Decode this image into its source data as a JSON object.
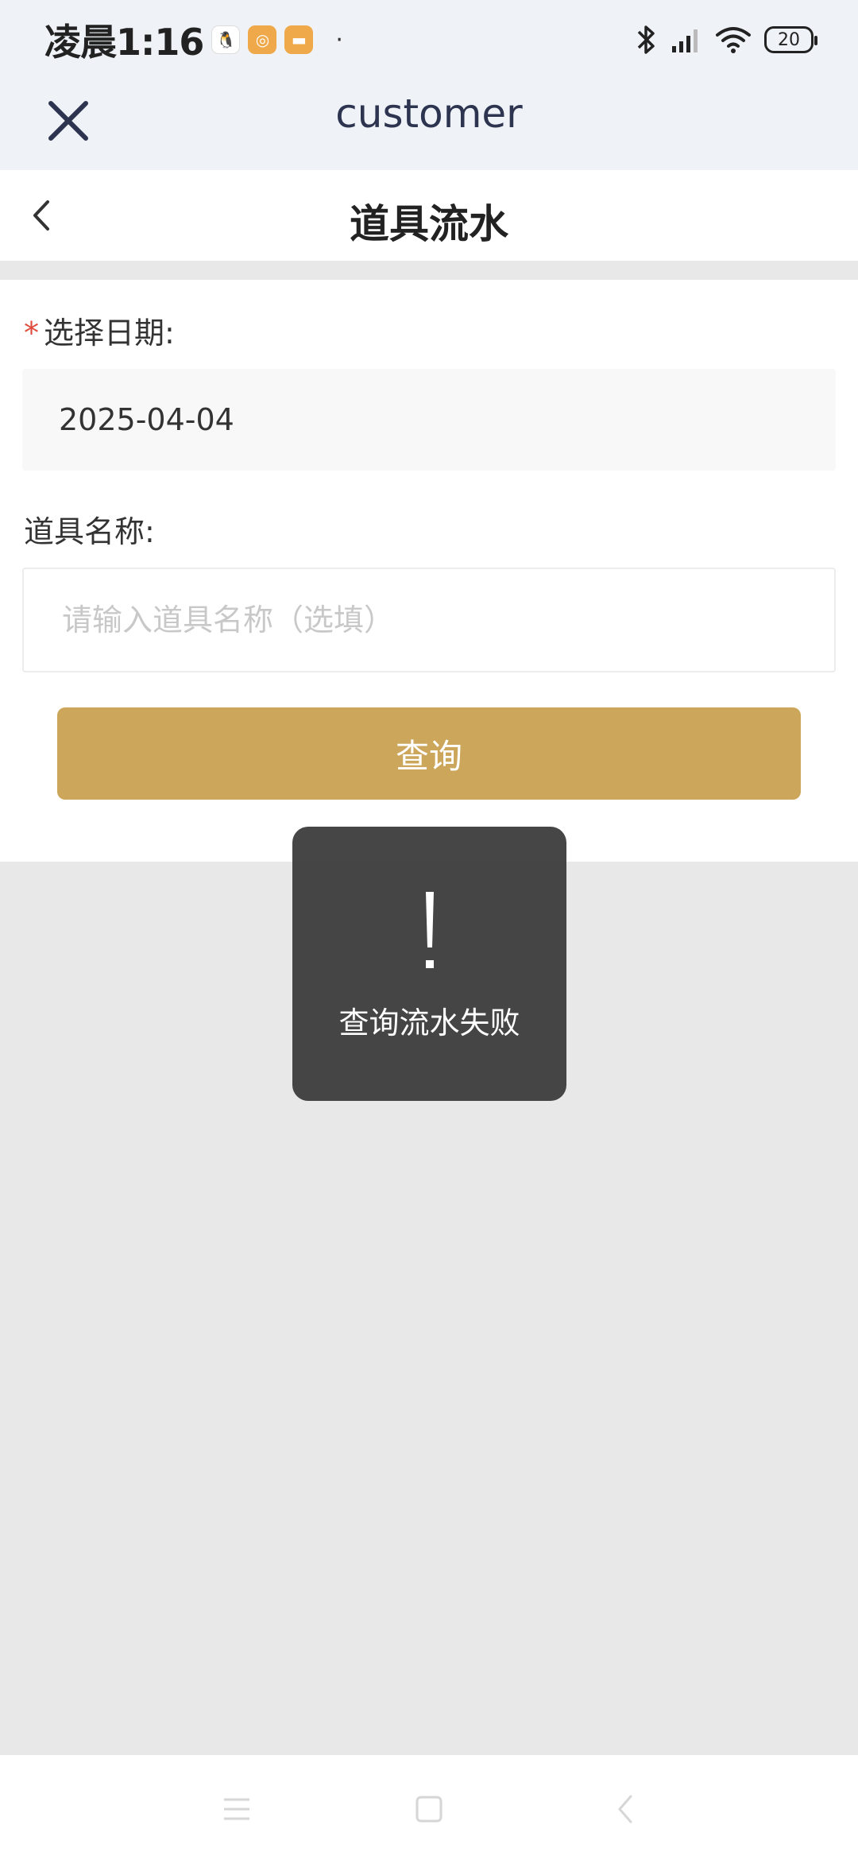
{
  "status_bar": {
    "time": "凌晨1:16",
    "dot": "·",
    "battery": "20",
    "app_icons": [
      "qq-icon",
      "target-app-icon",
      "chat-app-icon"
    ],
    "system_icons": [
      "bluetooth-icon",
      "signal-icon",
      "wifi-icon",
      "battery-icon"
    ]
  },
  "title_bar": {
    "title": "customer",
    "close_icon": "close-icon"
  },
  "page_header": {
    "title": "道具流水",
    "back_icon": "chevron-left-icon"
  },
  "form": {
    "date_label": "选择日期:",
    "required_mark": "*",
    "date_value": "2025-04-04",
    "item_name_label": "道具名称:",
    "item_name_value": "",
    "item_name_placeholder": "请输入道具名称（选填）",
    "query_button": "查询"
  },
  "toast": {
    "icon": "exclamation-icon",
    "message": "查询流水失败"
  },
  "nav_bar": {
    "icons": [
      "menu-icon",
      "home-icon",
      "back-icon"
    ]
  },
  "colors": {
    "accent": "#cca65a",
    "required": "#e04b3d",
    "header_bg": "#eff3f7",
    "page_bg": "#e8e8e8",
    "toast_bg": "#383838"
  }
}
